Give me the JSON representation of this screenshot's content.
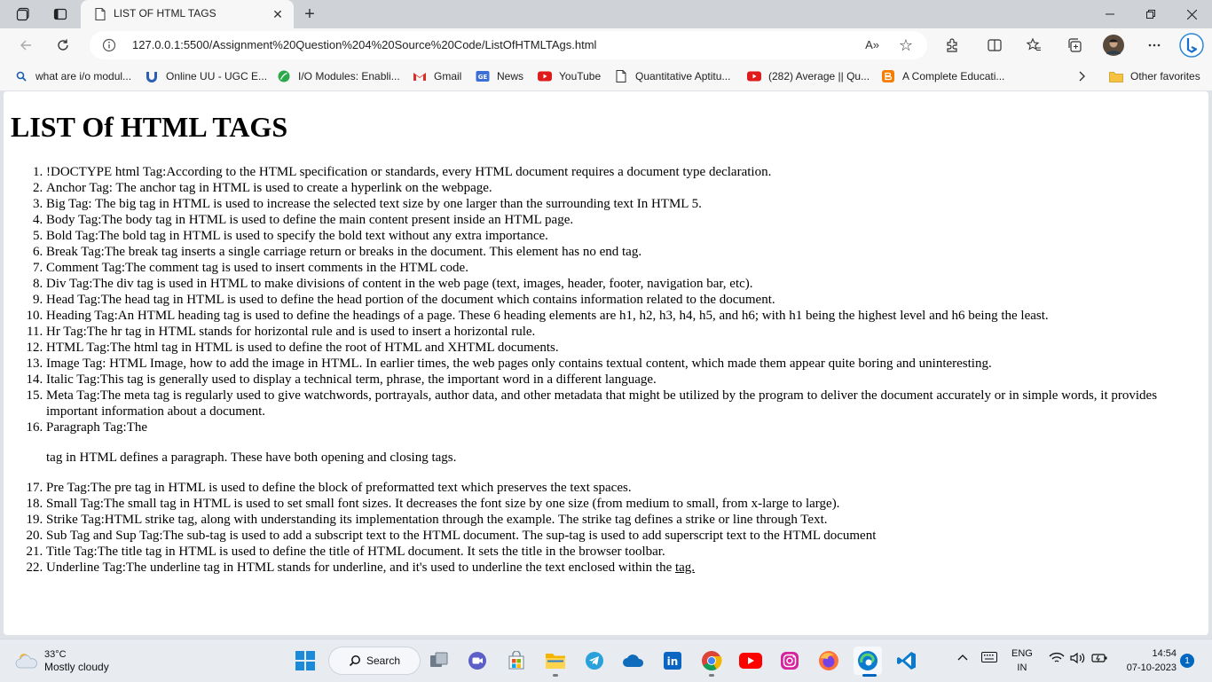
{
  "browser": {
    "tab_title": "LIST OF HTML TAGS",
    "url": "127.0.0.1:5500/Assignment%20Question%204%20Source%20Code/ListOfHTMLTAgs.html",
    "read_aloud_label": "A»"
  },
  "bookmarks": [
    {
      "label": "what are i/o modul...",
      "icon": "search-icon"
    },
    {
      "label": "Online UU - UGC E...",
      "icon": "uu-icon"
    },
    {
      "label": "I/O Modules: Enabli...",
      "icon": "leaf-icon"
    },
    {
      "label": "Gmail",
      "icon": "gmail-icon"
    },
    {
      "label": "News",
      "icon": "news-icon"
    },
    {
      "label": "YouTube",
      "icon": "youtube-icon"
    },
    {
      "label": "Quantitative Aptitu...",
      "icon": "page-icon"
    },
    {
      "label": "(282) Average || Qu...",
      "icon": "youtube-icon"
    },
    {
      "label": "A Complete Educati...",
      "icon": "blogger-icon"
    }
  ],
  "other_favorites": "Other favorites",
  "page": {
    "heading": "LIST Of HTML TAGS",
    "items": [
      "!DOCTYPE html Tag:According to the HTML specification or standards, every HTML document requires a document type declaration.",
      "Anchor Tag: The anchor tag in HTML is used to create a hyperlink on the webpage.",
      "Big Tag: The big tag in HTML is used to increase the selected text size by one larger than the surrounding text In HTML 5.",
      "Body Tag:The body tag in HTML is used to define the main content present inside an HTML page.",
      "Bold Tag:The bold tag in HTML is used to specify the bold text without any extra importance.",
      "Break Tag:The break tag inserts a single carriage return or breaks in the document. This element has no end tag.",
      "Comment Tag:The comment tag is used to insert comments in the HTML code.",
      "Div Tag:The div tag is used in HTML to make divisions of content in the web page (text, images, header, footer, navigation bar, etc).",
      "Head Tag:The head tag in HTML is used to define the head portion of the document which contains information related to the document.",
      "Heading Tag:An HTML heading tag is used to define the headings of a page. These 6 heading elements are h1, h2, h3, h4, h5, and h6; with h1 being the highest level and h6 being the least.",
      "Hr Tag:The hr tag in HTML stands for horizontal rule and is used to insert a horizontal rule.",
      "HTML Tag:The html tag in HTML is used to define the root of HTML and XHTML documents.",
      "Image Tag: HTML Image, how to add the image in HTML. In earlier times, the web pages only contains textual content, which made them appear quite boring and uninteresting.",
      "Italic Tag:This tag is generally used to display a technical term, phrase, the important word in a different language.",
      "Meta Tag:The meta tag is regularly used to give watchwords, portrayals, author data, and other metadata that might be utilized by the program to deliver the document accurately or in simple words, it provides important information about a document."
    ],
    "paragraph_item_lead": "Paragraph Tag:The",
    "paragraph_item_para": "tag in HTML defines a paragraph. These have both opening and closing tags.",
    "items_after": [
      "Pre Tag:The pre tag in HTML is used to define the block of preformatted text which preserves the text spaces.",
      "Small Tag:The small tag in HTML is used to set small font sizes. It decreases the font size by one size (from medium to small, from x-large to large).",
      "Strike Tag:HTML strike tag, along with understanding its implementation through the example. The strike tag defines a strike or line through Text.",
      "Sub Tag and Sup Tag:The sub-tag is used to add a subscript text to the HTML document. The sup-tag is used to add superscript text to the HTML document",
      "Title Tag:The title tag in HTML is used to define the title of HTML document. It sets the title in the browser toolbar."
    ],
    "underline_item_text": "Underline Tag:The underline tag in HTML stands for underline, and it's used to underline the text enclosed within the ",
    "underline_item_word": "tag."
  },
  "taskbar": {
    "weather_temp": "33°C",
    "weather_desc": "Mostly cloudy",
    "search_label": "Search",
    "lang_line1": "ENG",
    "lang_line2": "IN",
    "time": "14:54",
    "date": "07-10-2023",
    "notification_count": "1"
  },
  "colors": {
    "tabstrip_bg": "#cfd3d8",
    "toolbar_bg": "#f7f7f7",
    "taskbar_bg": "#e8ecf1",
    "accent_blue": "#0067c0"
  }
}
